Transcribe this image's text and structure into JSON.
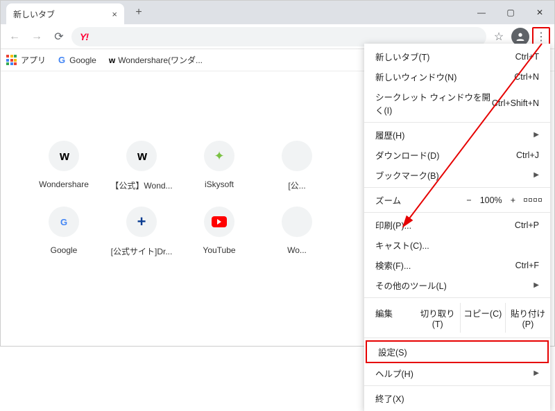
{
  "window": {
    "tab_title": "新しいタブ"
  },
  "toolbar": {
    "url_text": "Y!"
  },
  "bookmarks": {
    "apps": "アプリ",
    "google": "Google",
    "wondershare": "Wondershare(ワンダ..."
  },
  "tiles": [
    {
      "label": "Wondershare"
    },
    {
      "label": "【公式】Wond..."
    },
    {
      "label": "iSkysoft"
    },
    {
      "label": "[公..."
    },
    {
      "label": ""
    },
    {
      "label": "Google"
    },
    {
      "label": "[公式サイト]Dr..."
    },
    {
      "label": "YouTube"
    },
    {
      "label": "Wo..."
    },
    {
      "label": ""
    }
  ],
  "menu": {
    "new_tab": {
      "label": "新しいタブ(T)",
      "shortcut": "Ctrl+T"
    },
    "new_window": {
      "label": "新しいウィンドウ(N)",
      "shortcut": "Ctrl+N"
    },
    "incognito": {
      "label": "シークレット ウィンドウを開く(I)",
      "shortcut": "Ctrl+Shift+N"
    },
    "history": {
      "label": "履歴(H)"
    },
    "downloads": {
      "label": "ダウンロード(D)",
      "shortcut": "Ctrl+J"
    },
    "bookmarks": {
      "label": "ブックマーク(B)"
    },
    "zoom": {
      "label": "ズーム",
      "value": "100%",
      "minus": "−",
      "plus": "+"
    },
    "print": {
      "label": "印刷(P)...",
      "shortcut": "Ctrl+P"
    },
    "cast": {
      "label": "キャスト(C)..."
    },
    "find": {
      "label": "検索(F)...",
      "shortcut": "Ctrl+F"
    },
    "more_tools": {
      "label": "その他のツール(L)"
    },
    "edit": {
      "label": "編集",
      "cut": "切り取り(T)",
      "copy": "コピー(C)",
      "paste": "貼り付け(P)"
    },
    "settings": {
      "label": "設定(S)"
    },
    "help": {
      "label": "ヘルプ(H)"
    },
    "exit": {
      "label": "終了(X)"
    }
  }
}
